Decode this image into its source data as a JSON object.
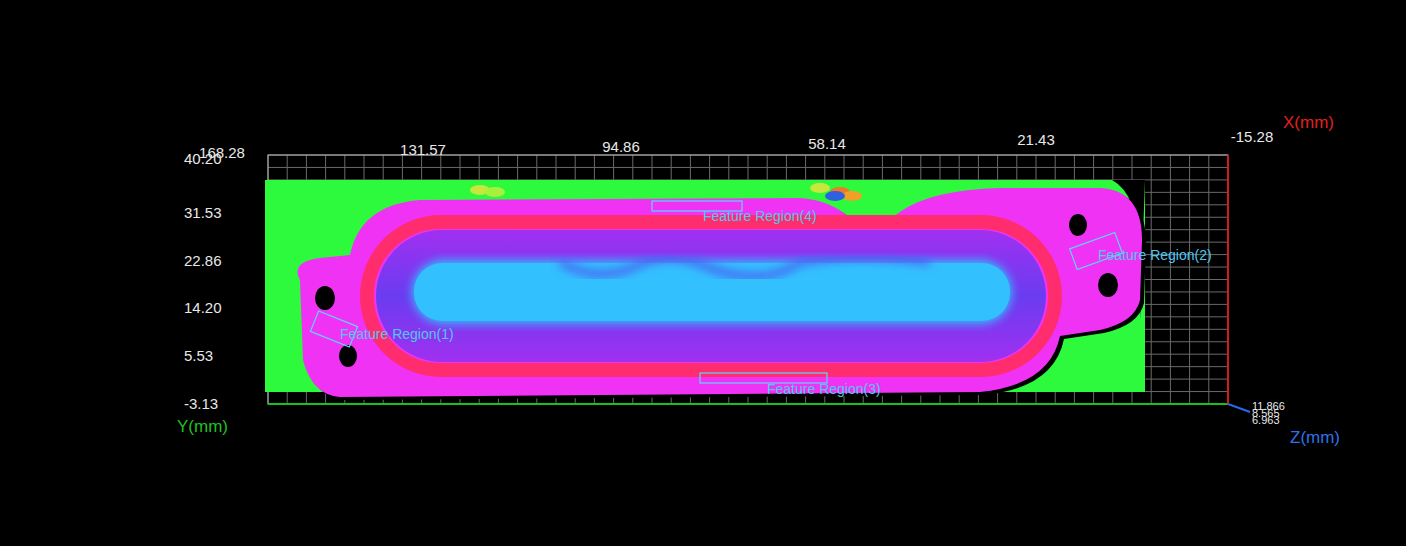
{
  "axes": {
    "x": {
      "label": "X(mm)",
      "ticks": [
        "168.28",
        "131.57",
        "94.86",
        "58.14",
        "21.43",
        "-15.28"
      ]
    },
    "y": {
      "label": "Y(mm)",
      "ticks": [
        "40.20",
        "31.53",
        "22.86",
        "14.20",
        "5.53",
        "-3.13"
      ]
    },
    "z": {
      "label": "Z(mm)",
      "ticks": [
        "11.866",
        "8.565",
        "6.963"
      ]
    }
  },
  "feature_regions": [
    {
      "label": "Feature Region(1)"
    },
    {
      "label": "Feature Region(2)"
    },
    {
      "label": "Feature Region(3)"
    },
    {
      "label": "Feature Region(4)"
    }
  ]
}
